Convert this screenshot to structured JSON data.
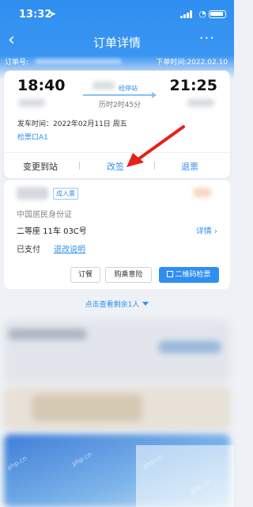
{
  "status_bar": {
    "time": "13:32",
    "location_icon": "location-arrow-icon",
    "signal_icon": "signal-icon",
    "wifi_icon": "wifi-icon",
    "battery_icon": "battery-icon"
  },
  "nav": {
    "back_icon": "chevron-left-icon",
    "title": "订单详情",
    "more_icon": "more-dots-icon"
  },
  "order": {
    "order_no_label": "订单号:",
    "order_time": "下单时间:2022.02.10"
  },
  "trip": {
    "depart_time": "18:40",
    "arrive_time": "21:25",
    "via_label": "经停站",
    "duration": "历时2时45分",
    "depart_date": "发车时间：2022年02月11日 周五",
    "gate": "检票口A1",
    "actions": [
      "变更到站",
      "改签",
      "退票"
    ]
  },
  "passenger": {
    "ticket_type": "成人票",
    "id_type": "中国居民身份证",
    "seat": "二等座 11车 03C号",
    "detail_link": "详情 ›",
    "pay_status": "已支付",
    "refund_policy": "退改说明",
    "buttons": [
      "订餐",
      "购乘意险",
      "二维码检票"
    ]
  },
  "show_more": "点击查看剩余1人",
  "watermark": "php.cn",
  "colors": {
    "accent": "#2f8ff0",
    "highlight_arrow": "#e8201a",
    "background": "#eef1f5"
  }
}
